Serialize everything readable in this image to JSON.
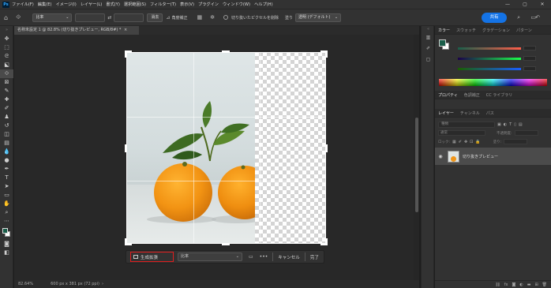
{
  "app": {
    "logo": "Ps"
  },
  "menu": [
    "ファイル(F)",
    "編集(E)",
    "イメージ(I)",
    "レイヤー(L)",
    "書式(Y)",
    "選択範囲(S)",
    "フィルター(T)",
    "表示(V)",
    "プラグイン",
    "ウィンドウ(W)",
    "ヘルプ(H)"
  ],
  "window_controls": {
    "minimize": "—",
    "maximize": "▢",
    "close": "✕"
  },
  "options": {
    "ratio_select": "比率",
    "clear_button": "消去",
    "straighten_button": "角度補正",
    "delete_cropped_label": "切り抜いたピクセルを削除",
    "fill_label": "塗り",
    "fill_select": "透明 (デフォルト)",
    "share_button": "共有"
  },
  "document": {
    "tab_title": "名称未設定 1 @ 82.8% (切り抜きプレビュー, RGB/8#) *",
    "tab_close": "×"
  },
  "context_bar": {
    "generative_fill": "生成拡張",
    "ratio_select": "比率",
    "more": "•••",
    "cancel": "キャンセル",
    "done": "完了"
  },
  "status": {
    "zoom": "82.64%",
    "doc_size": "600 px x 381 px (72 ppi)"
  },
  "panels": {
    "color_tabs": [
      "カラー",
      "スウォッチ",
      "グラデーション",
      "パターン"
    ],
    "adjust_tabs": [
      "プロパティ",
      "色調補正",
      "CC ライブラリ"
    ],
    "layer_tabs": [
      "レイヤー",
      "チャンネル",
      "パス"
    ],
    "layers_search": "種類",
    "blend_mode": "通常",
    "opacity_label": "不透明度:",
    "lock_label": "ロック:",
    "fill_label": "塗り:",
    "layer_name": "切り抜きプレビュー"
  },
  "colors": {
    "foreground": "#1a5e4a",
    "background": "#ffffff",
    "accent": "#1473e6",
    "highlight": "#e11d1d"
  }
}
